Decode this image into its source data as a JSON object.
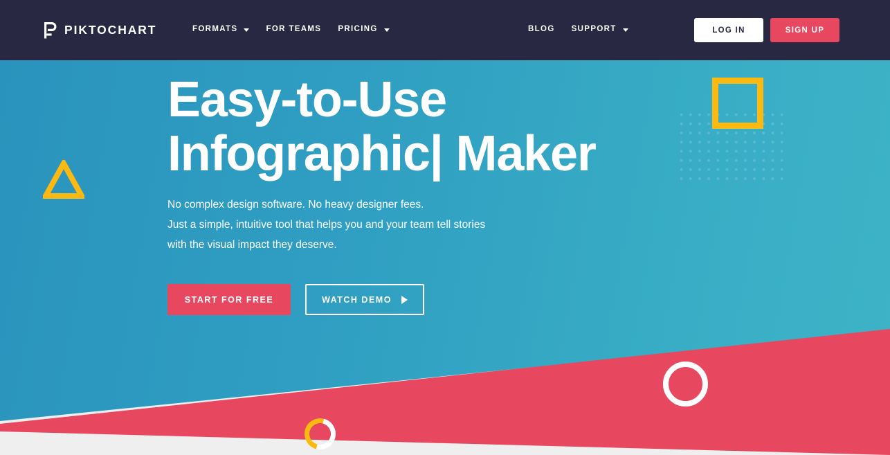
{
  "navbar": {
    "logo_text": "PIKTOCHART",
    "logo_icon": "piktochart-p-logo-icon",
    "left_items": [
      {
        "label": "FORMATS",
        "has_caret": true
      },
      {
        "label": "FOR TEAMS",
        "has_caret": false
      },
      {
        "label": "PRICING",
        "has_caret": true
      }
    ],
    "right_items": [
      {
        "label": "BLOG",
        "has_caret": false
      },
      {
        "label": "SUPPORT",
        "has_caret": true
      }
    ],
    "login_label": "LOG IN",
    "signup_label": "SIGN UP",
    "background_color": "#282843",
    "signup_color": "#e7475f"
  },
  "hero": {
    "headline_line1": "Easy-to-Use",
    "headline_line2": "Infographic| Maker",
    "subtext_line1": "No complex design software. No heavy designer fees.",
    "subtext_line2": "Just a simple, intuitive tool that helps you and your team tell stories",
    "subtext_line3": "with the visual impact they deserve.",
    "cta_primary": "START FOR FREE",
    "cta_secondary": "WATCH DEMO",
    "play_icon": "play-triangle-icon",
    "teal_color": "#309fc2",
    "pink_color": "#e7475f",
    "yellow_color": "#fbb912"
  },
  "decorations": {
    "triangle": "yellow-triangle-outline-icon",
    "square": "yellow-square-outline-icon",
    "dots": "dot-grid-pattern",
    "circle": "white-ring-circle-icon",
    "spinner": "loading-spinner-icon"
  }
}
